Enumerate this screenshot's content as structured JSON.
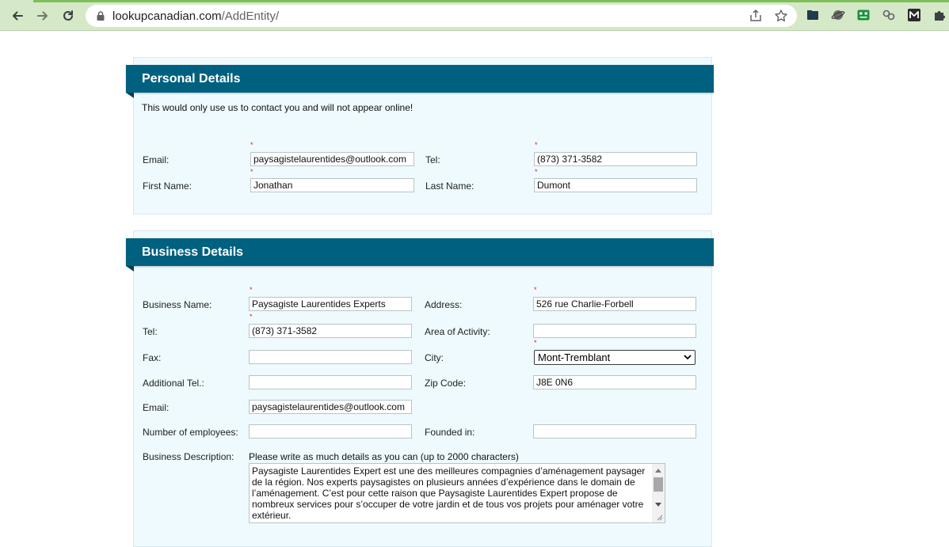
{
  "browser": {
    "url_host": "lookupcanadian.com",
    "url_path": "/AddEntity/",
    "accent": "#d5e8c8"
  },
  "personal": {
    "title": "Personal Details",
    "intro": "This would only use us to contact you and will not appear online!",
    "required_mark": "*",
    "email_label": "Email:",
    "email_value": "paysagistelaurentides@outlook.com",
    "tel_label": "Tel:",
    "tel_value": "(873) 371-3582",
    "first_name_label": "First Name:",
    "first_name_value": "Jonathan",
    "last_name_label": "Last Name:",
    "last_name_value": "Dumont"
  },
  "business": {
    "title": "Business Details",
    "required_mark": "*",
    "name_label": "Business Name:",
    "name_value": "Paysagiste Laurentides Experts",
    "address_label": "Address:",
    "address_value": "526 rue Charlie-Forbell",
    "tel_label": "Tel:",
    "tel_value": "(873) 371-3582",
    "area_label": "Area of Activity:",
    "area_value": "",
    "fax_label": "Fax:",
    "fax_value": "",
    "city_label": "City:",
    "city_value": "Mont-Tremblant",
    "additional_tel_label": "Additional Tel.:",
    "additional_tel_value": "",
    "zip_label": "Zip Code:",
    "zip_value": "J8E 0N6",
    "email_label": "Email:",
    "email_value": "paysagistelaurentides@outlook.com",
    "employees_label": "Number of employees:",
    "employees_value": "",
    "founded_label": "Founded in:",
    "founded_value": "",
    "description_label": "Business Description:",
    "description_hint": "Please write as much details as you can (up to 2000 characters)",
    "description_value": "Paysagiste Laurentides Expert est une des meilleures compagnies d’aménagement paysager de la région. Nos experts paysagistes on plusieurs années d’expérience dans le domain de l’aménagement. C’est pour cette raison que Paysagiste Laurentides Expert propose de nombreux services pour s’occuper de votre jardin et de tous vos projets pour aménager votre extérieur."
  },
  "colors": {
    "header_bg": "#00607f",
    "panel_bg": "#eefafd",
    "required": "#e0201f"
  },
  "icons": [
    "back-arrow-icon",
    "forward-arrow-icon",
    "reload-icon",
    "lock-icon",
    "share-icon",
    "bookmark-star-icon",
    "extension-icon"
  ]
}
